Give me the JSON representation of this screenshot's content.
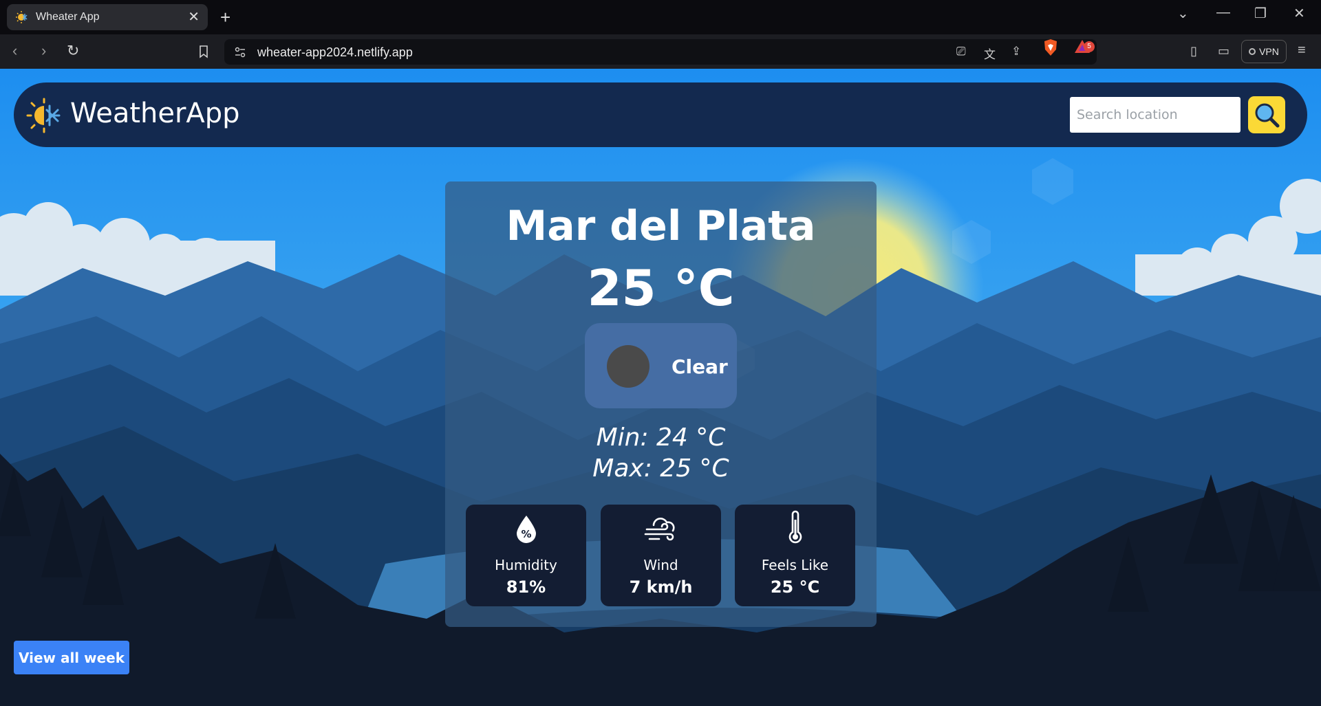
{
  "browser": {
    "tab_title": "Wheater App",
    "tab_close": "✕",
    "new_tab": "+",
    "url": "wheater-app2024.netlify.app",
    "notification_count": "5",
    "vpn_label": "VPN"
  },
  "app": {
    "logo_text": "WeatherApp",
    "search": {
      "placeholder": "Search location"
    },
    "weather": {
      "city": "Mar del Plata",
      "temperature": "25 °C",
      "condition": "Clear",
      "min": "Min: 24 °C",
      "max": "Max: 25 °C"
    },
    "stats": [
      {
        "label": "Humidity",
        "value": "81%",
        "icon": "humidity-drop-icon"
      },
      {
        "label": "Wind",
        "value": "7 km/h",
        "icon": "wind-icon"
      },
      {
        "label": "Feels Like",
        "value": "25 °C",
        "icon": "thermometer-icon"
      }
    ],
    "view_week_label": "View all week",
    "colors": {
      "header_bg": "#13294f",
      "search_button": "#fbd936",
      "week_button": "#3b82f6",
      "stat_card": "#131d33"
    }
  }
}
